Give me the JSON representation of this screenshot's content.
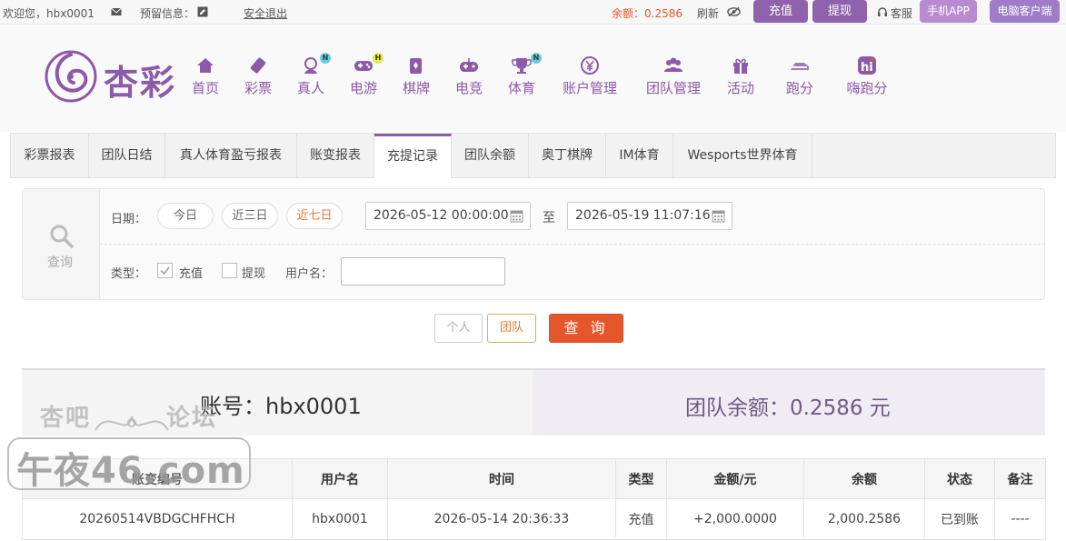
{
  "topbar": {
    "welcome": "欢迎您，hbx0001",
    "reserved_label": "预留信息：",
    "logout": "安全退出",
    "balance": "余额：0.2586",
    "refresh": "刷新",
    "deposit": "充值",
    "withdraw": "提现",
    "service": "客服",
    "mobile_app": "手机APP",
    "pc_client": "电脑客户端"
  },
  "brand": {
    "logo_text": "杏彩"
  },
  "nav": [
    {
      "label": "首页",
      "icon": "home-icon"
    },
    {
      "label": "彩票",
      "icon": "lottery-icon"
    },
    {
      "label": "真人",
      "icon": "live-dealer-icon",
      "badge": "N"
    },
    {
      "label": "电游",
      "icon": "gamepad-icon",
      "badge": "H"
    },
    {
      "label": "棋牌",
      "icon": "cards-icon"
    },
    {
      "label": "电竞",
      "icon": "esports-controller-icon"
    },
    {
      "label": "体育",
      "icon": "trophy-icon",
      "badge": "N"
    },
    {
      "label": "账户管理",
      "icon": "yen-coin-icon"
    },
    {
      "label": "团队管理",
      "icon": "team-icon"
    },
    {
      "label": "活动",
      "icon": "gift-icon"
    },
    {
      "label": "跑分",
      "icon": "running-score-icon"
    },
    {
      "label": "嗨跑分",
      "icon": "hi-app-icon"
    }
  ],
  "tabs": [
    "彩票报表",
    "团队日结",
    "真人体育盈亏报表",
    "账变报表",
    "充提记录",
    "团队余额",
    "奥丁棋牌",
    "IM体育",
    "Wesports世界体育"
  ],
  "active_tab": "充提记录",
  "filter": {
    "search_label": "查询",
    "date_label": "日期：",
    "today": "今日",
    "three_days": "近三日",
    "seven_days": "近七日",
    "start_date": "2026-05-12 00:00:00",
    "to": "至",
    "end_date": "2026-05-19 11:07:16",
    "type_label": "类型：",
    "deposit_option": "充值",
    "withdraw_option": "提现",
    "username_label": "用户名：",
    "username_value": ""
  },
  "buttons": {
    "personal": "个人",
    "team": "团队",
    "query": "查 询"
  },
  "summary": {
    "account": "账号：hbx0001",
    "team_balance": "团队余额：0.2586 元"
  },
  "table": {
    "headers": [
      "账变编号",
      "用户名",
      "时间",
      "类型",
      "金额/元",
      "余额",
      "状态",
      "备注"
    ],
    "rows": [
      [
        "20260514VBDGCHFHCH",
        "hbx0001",
        "2026-05-14 20:36:33",
        "充值",
        "+2,000.0000",
        "2,000.2586",
        "已到账",
        "----"
      ]
    ]
  },
  "watermark": {
    "line1a": "杏吧",
    "line1b": "论坛",
    "line2": "午夜46.com"
  },
  "colors": {
    "brand": "#8b5aa8",
    "accent_orange": "#e5572a",
    "positive": "#4a9a2c"
  }
}
